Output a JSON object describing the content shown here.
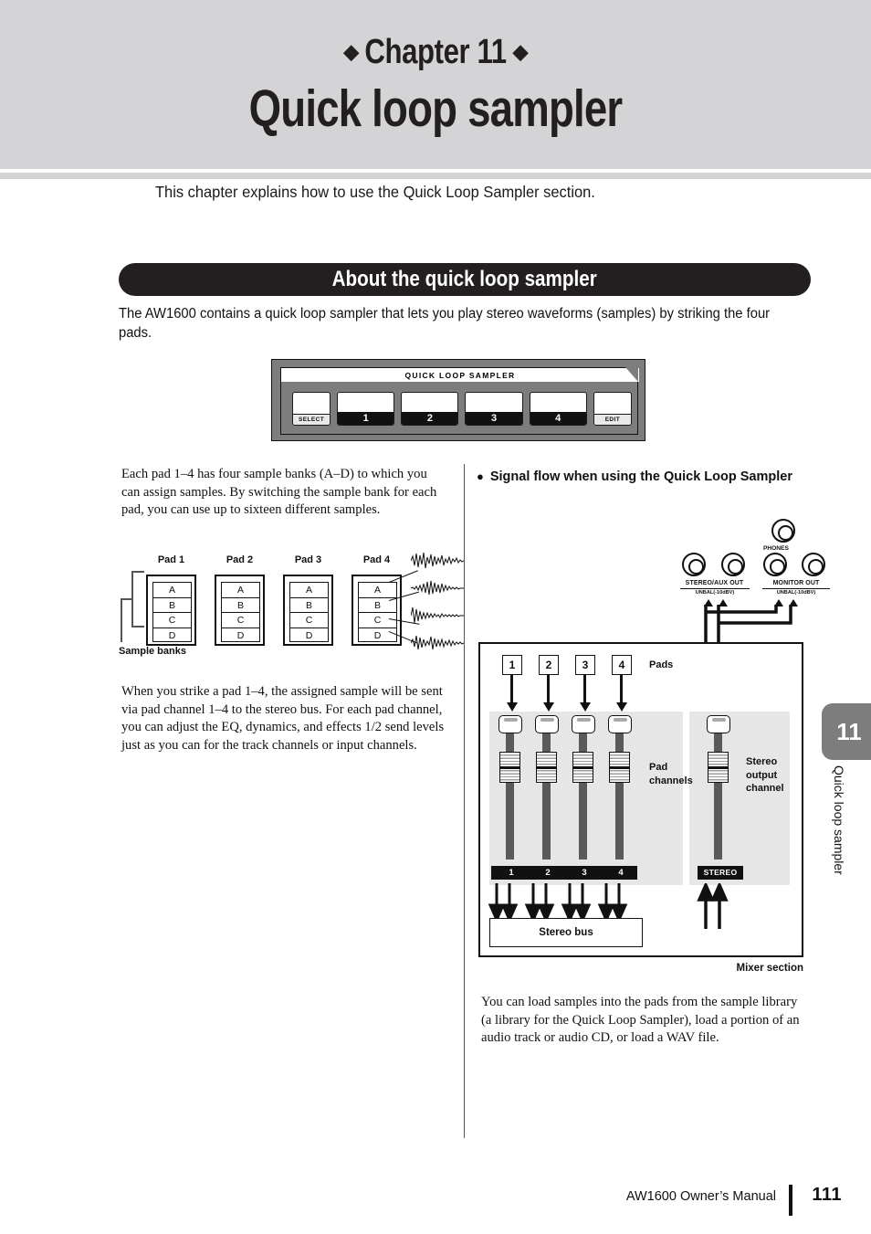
{
  "header": {
    "chapter_label": "Chapter 11",
    "diamond": "◆",
    "chapter_title": "Quick loop sampler",
    "intro": "This chapter explains how to use the Quick Loop Sampler section."
  },
  "section": {
    "banner_title": "About the quick loop sampler",
    "lead_paragraph": "The AW1600 contains a quick loop sampler that lets you play stereo waveforms (samples) by striking the four pads."
  },
  "hardware_panel": {
    "caption": "QUICK  LOOP  SAMPLER",
    "buttons": [
      {
        "label": "SELECT",
        "style": "light"
      },
      {
        "label": "1",
        "style": "dark"
      },
      {
        "label": "2",
        "style": "dark"
      },
      {
        "label": "3",
        "style": "dark"
      },
      {
        "label": "4",
        "style": "dark"
      },
      {
        "label": "EDIT",
        "style": "light"
      }
    ]
  },
  "left_column": {
    "paragraph_1": "Each pad 1–4 has four sample banks (A–D) to which you can assign samples. By switching the sample bank for each pad, you can use up to sixteen different samples.",
    "paragraph_2": "When you strike a pad 1–4, the assigned sample will be sent via pad channel 1–4 to the stereo bus. For each pad channel, you can adjust the EQ, dynamics, and effects 1/2 send levels just as you can for the track channels or input channels.",
    "pad_figure": {
      "pads": [
        {
          "title": "Pad 1",
          "banks": [
            "A",
            "B",
            "C",
            "D"
          ]
        },
        {
          "title": "Pad 2",
          "banks": [
            "A",
            "B",
            "C",
            "D"
          ]
        },
        {
          "title": "Pad 3",
          "banks": [
            "A",
            "B",
            "C",
            "D"
          ]
        },
        {
          "title": "Pad 4",
          "banks": [
            "A",
            "B",
            "C",
            "D"
          ]
        }
      ],
      "bracket_label": "Sample banks",
      "waveform_count": 4
    }
  },
  "right_column": {
    "heading_bullet": "●",
    "heading": "Signal flow when using the Quick Loop Sampler",
    "jacks": {
      "phones_label": "PHONES",
      "groups": [
        {
          "label": "STEREO/AUX OUT",
          "sub": "UNBAL(-10dBV)"
        },
        {
          "label": "MONITOR OUT",
          "sub": "UNBAL(-10dBV)"
        }
      ]
    },
    "mixer": {
      "pads_label": "Pads",
      "pad_boxes": [
        "1",
        "2",
        "3",
        "4"
      ],
      "pad_channels_label": "Pad\nchannels",
      "pad_channels_label_line1": "Pad",
      "pad_channels_label_line2": "channels",
      "stereo_channel_label_line1": "Stereo",
      "stereo_channel_label_line2": "output",
      "stereo_channel_label_line3": "channel",
      "channel_numbers": [
        "1",
        "2",
        "3",
        "4"
      ],
      "stereo_bar_label": "STEREO",
      "stereo_bus_label": "Stereo bus",
      "caption": "Mixer section"
    },
    "paragraph": "You can load samples into the pads from the sample library (a library for the Quick Loop Sampler), load a portion of an audio track or audio CD, or load a WAV file."
  },
  "side_tab": {
    "number": "11",
    "vertical_title": "Quick loop sampler"
  },
  "footer": {
    "manual": "AW1600  Owner’s Manual",
    "page": "111"
  },
  "colors": {
    "band_gray": "#d4d4d6",
    "banner_black": "#231f20",
    "panel_gray": "#7d7d7d",
    "shade_gray": "#e6e6e6",
    "fader_gray": "#5a5a5a"
  }
}
